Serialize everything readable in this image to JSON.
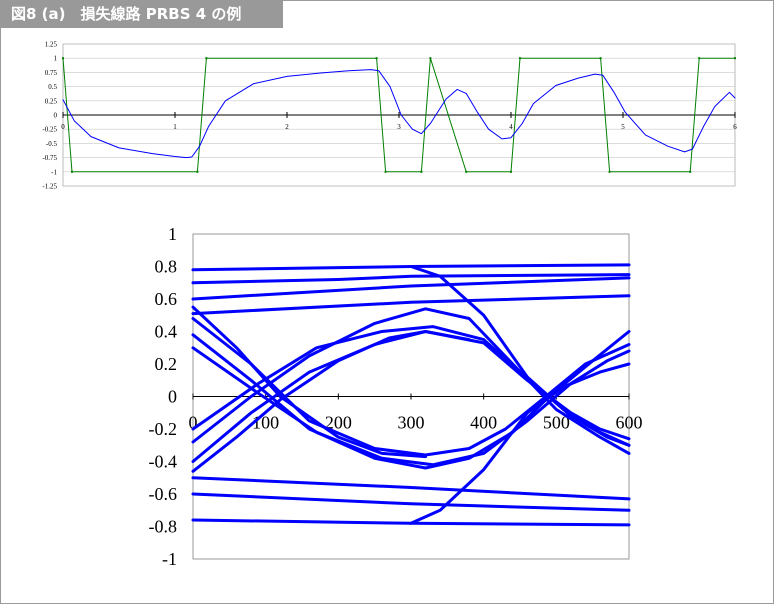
{
  "figure": {
    "title": "図8 (a)　損失線路 PRBS 4 の例"
  },
  "chart_data": [
    {
      "type": "line",
      "xlim": [
        0,
        6
      ],
      "ylim": [
        -1.25,
        1.25
      ],
      "x_ticks": [
        "0",
        "1",
        "2",
        "3",
        "4",
        "5",
        "6"
      ],
      "y_ticks": [
        "1.25",
        "1",
        "0.75",
        "0.5",
        "0.25",
        "0",
        "-0.25",
        "-0.5",
        "-0.75",
        "-1",
        "-1.25"
      ],
      "grid": true,
      "series": [
        {
          "color": "#008000",
          "points": [
            [
              0,
              1
            ],
            [
              0.08,
              -1
            ],
            [
              1.2,
              -1
            ],
            [
              1.28,
              1
            ],
            [
              2.8,
              1
            ],
            [
              2.88,
              -1
            ],
            [
              3.2,
              -1
            ],
            [
              3.28,
              1
            ],
            [
              3.6,
              -1
            ],
            [
              4.0,
              -1
            ],
            [
              4.08,
              1
            ],
            [
              4.8,
              1
            ],
            [
              4.88,
              -1
            ],
            [
              5.6,
              -1
            ],
            [
              5.68,
              1
            ],
            [
              6,
              1
            ]
          ]
        },
        {
          "color": "#0000ff",
          "points": [
            [
              0,
              0.27
            ],
            [
              0.1,
              -0.1
            ],
            [
              0.25,
              -0.38
            ],
            [
              0.5,
              -0.58
            ],
            [
              0.8,
              -0.68
            ],
            [
              1.0,
              -0.73
            ],
            [
              1.1,
              -0.75
            ],
            [
              1.15,
              -0.74
            ],
            [
              1.22,
              -0.55
            ],
            [
              1.3,
              -0.2
            ],
            [
              1.45,
              0.25
            ],
            [
              1.7,
              0.55
            ],
            [
              2.0,
              0.68
            ],
            [
              2.3,
              0.74
            ],
            [
              2.55,
              0.78
            ],
            [
              2.75,
              0.8
            ],
            [
              2.82,
              0.78
            ],
            [
              2.92,
              0.5
            ],
            [
              3.02,
              0.0
            ],
            [
              3.12,
              -0.25
            ],
            [
              3.2,
              -0.33
            ],
            [
              3.28,
              -0.15
            ],
            [
              3.42,
              0.28
            ],
            [
              3.52,
              0.45
            ],
            [
              3.6,
              0.38
            ],
            [
              3.7,
              0.05
            ],
            [
              3.8,
              -0.25
            ],
            [
              3.92,
              -0.42
            ],
            [
              4.0,
              -0.4
            ],
            [
              4.1,
              -0.15
            ],
            [
              4.2,
              0.2
            ],
            [
              4.4,
              0.52
            ],
            [
              4.6,
              0.65
            ],
            [
              4.75,
              0.72
            ],
            [
              4.82,
              0.7
            ],
            [
              4.92,
              0.4
            ],
            [
              5.02,
              0.05
            ],
            [
              5.2,
              -0.35
            ],
            [
              5.4,
              -0.55
            ],
            [
              5.55,
              -0.65
            ],
            [
              5.62,
              -0.6
            ],
            [
              5.72,
              -0.2
            ],
            [
              5.82,
              0.15
            ],
            [
              5.95,
              0.4
            ],
            [
              6.0,
              0.3
            ]
          ]
        }
      ]
    },
    {
      "type": "line",
      "xlim": [
        0,
        600
      ],
      "ylim": [
        -1,
        1
      ],
      "x_ticks": [
        "0",
        "100",
        "200",
        "300",
        "400",
        "500",
        "600"
      ],
      "y_ticks": [
        "1",
        "0.8",
        "0.6",
        "0.4",
        "0.2",
        "0",
        "-0.2",
        "-0.4",
        "-0.6",
        "-0.8",
        "-1"
      ],
      "grid": false,
      "series": [
        {
          "color": "#0000ff",
          "points": [
            [
              0,
              0.78
            ],
            [
              300,
              0.8
            ],
            [
              600,
              0.81
            ]
          ]
        },
        {
          "color": "#0000ff",
          "points": [
            [
              0,
              0.7
            ],
            [
              200,
              0.72
            ],
            [
              300,
              0.74
            ],
            [
              600,
              0.75
            ]
          ]
        },
        {
          "color": "#0000ff",
          "points": [
            [
              0,
              0.6
            ],
            [
              300,
              0.68
            ],
            [
              600,
              0.73
            ]
          ]
        },
        {
          "color": "#0000ff",
          "points": [
            [
              0,
              0.51
            ],
            [
              300,
              0.58
            ],
            [
              600,
              0.62
            ]
          ]
        },
        {
          "color": "#0000ff",
          "points": [
            [
              0,
              -0.5
            ],
            [
              300,
              -0.56
            ],
            [
              600,
              -0.63
            ]
          ]
        },
        {
          "color": "#0000ff",
          "points": [
            [
              0,
              -0.6
            ],
            [
              300,
              -0.66
            ],
            [
              600,
              -0.7
            ]
          ]
        },
        {
          "color": "#0000ff",
          "points": [
            [
              0,
              -0.76
            ],
            [
              300,
              -0.78
            ],
            [
              600,
              -0.79
            ]
          ]
        },
        {
          "color": "#0000ff",
          "points": [
            [
              0,
              0.48
            ],
            [
              80,
              0.2
            ],
            [
              160,
              -0.15
            ],
            [
              250,
              -0.32
            ],
            [
              320,
              -0.36
            ],
            [
              380,
              -0.32
            ],
            [
              430,
              -0.2
            ],
            [
              480,
              -0.02
            ],
            [
              540,
              0.2
            ],
            [
              600,
              0.32
            ]
          ]
        },
        {
          "color": "#0000ff",
          "points": [
            [
              0,
              0.38
            ],
            [
              80,
              0.1
            ],
            [
              160,
              -0.2
            ],
            [
              250,
              -0.38
            ],
            [
              320,
              -0.44
            ],
            [
              380,
              -0.38
            ],
            [
              440,
              -0.22
            ],
            [
              490,
              0.0
            ],
            [
              550,
              0.22
            ],
            [
              600,
              0.4
            ]
          ]
        },
        {
          "color": "#0000ff",
          "points": [
            [
              0,
              -0.28
            ],
            [
              80,
              0.0
            ],
            [
              160,
              0.25
            ],
            [
              250,
              0.45
            ],
            [
              320,
              0.54
            ],
            [
              380,
              0.48
            ],
            [
              440,
              0.2
            ],
            [
              500,
              -0.08
            ],
            [
              560,
              -0.25
            ],
            [
              600,
              -0.35
            ]
          ]
        },
        {
          "color": "#0000ff",
          "points": [
            [
              0,
              -0.2
            ],
            [
              90,
              0.08
            ],
            [
              170,
              0.3
            ],
            [
              260,
              0.4
            ],
            [
              330,
              0.43
            ],
            [
              400,
              0.35
            ],
            [
              450,
              0.15
            ],
            [
              510,
              -0.08
            ],
            [
              560,
              -0.22
            ],
            [
              600,
              -0.3
            ]
          ]
        },
        {
          "color": "#0000ff",
          "points": [
            [
              0,
              -0.4
            ],
            [
              80,
              -0.1
            ],
            [
              160,
              0.15
            ],
            [
              250,
              0.32
            ],
            [
              320,
              0.4
            ],
            [
              400,
              0.33
            ],
            [
              460,
              0.1
            ],
            [
              520,
              -0.1
            ],
            [
              560,
              -0.2
            ],
            [
              600,
              -0.26
            ]
          ]
        },
        {
          "color": "#0000ff",
          "points": [
            [
              0,
              0.3
            ],
            [
              90,
              0.02
            ],
            [
              170,
              -0.22
            ],
            [
              260,
              -0.38
            ],
            [
              330,
              -0.42
            ],
            [
              400,
              -0.35
            ],
            [
              460,
              -0.15
            ],
            [
              520,
              0.08
            ],
            [
              570,
              0.22
            ],
            [
              600,
              0.28
            ]
          ]
        },
        {
          "color": "#0000ff",
          "points": [
            [
              0,
              -0.46
            ],
            [
              60,
              -0.25
            ],
            [
              120,
              -0.02
            ],
            [
              200,
              0.22
            ],
            [
              270,
              0.36
            ],
            [
              320,
              0.4
            ],
            [
              380,
              0.35
            ]
          ]
        },
        {
          "color": "#0000ff",
          "points": [
            [
              300,
              -0.78
            ],
            [
              340,
              -0.7
            ],
            [
              400,
              -0.45
            ],
            [
              460,
              -0.1
            ],
            [
              510,
              0.06
            ],
            [
              560,
              0.15
            ],
            [
              600,
              0.2
            ]
          ]
        },
        {
          "color": "#0000ff",
          "points": [
            [
              300,
              0.8
            ],
            [
              340,
              0.74
            ],
            [
              400,
              0.5
            ],
            [
              460,
              0.12
            ],
            [
              520,
              -0.12
            ],
            [
              570,
              -0.25
            ],
            [
              600,
              -0.3
            ]
          ]
        },
        {
          "color": "#0000ff",
          "points": [
            [
              0,
              0.55
            ],
            [
              60,
              0.3
            ],
            [
              120,
              0.0
            ],
            [
              200,
              -0.25
            ],
            [
              260,
              -0.35
            ],
            [
              320,
              -0.37
            ]
          ]
        }
      ]
    }
  ]
}
